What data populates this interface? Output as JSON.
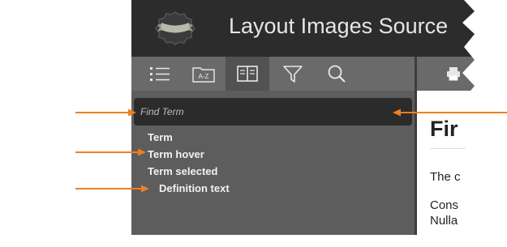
{
  "header": {
    "title": "Layout Images Source"
  },
  "toolbar": {
    "buttons": [
      {
        "name": "toc",
        "icon": "list-icon"
      },
      {
        "name": "index",
        "icon": "az-folder-icon",
        "label": "A-Z"
      },
      {
        "name": "glossary",
        "icon": "book-icon",
        "active": true
      },
      {
        "name": "filter",
        "icon": "filter-icon"
      },
      {
        "name": "search",
        "icon": "search-icon"
      }
    ],
    "print_icon": "printer-icon"
  },
  "glossary": {
    "search_placeholder": "Find Term",
    "terms": [
      "Term",
      "Term hover",
      "Term selected"
    ],
    "definition": "Definition text"
  },
  "content": {
    "heading": "Fir",
    "paragraph1": "The c",
    "paragraph2_line1": "Cons",
    "paragraph2_line2": "Nulla"
  },
  "colors": {
    "accent_arrow": "#f07f1e",
    "header_bg": "#2c2c2c",
    "panel_bg": "#5d5d5d",
    "toolbar_bg": "#6a6a6a",
    "search_bg": "#2b2b2b"
  }
}
